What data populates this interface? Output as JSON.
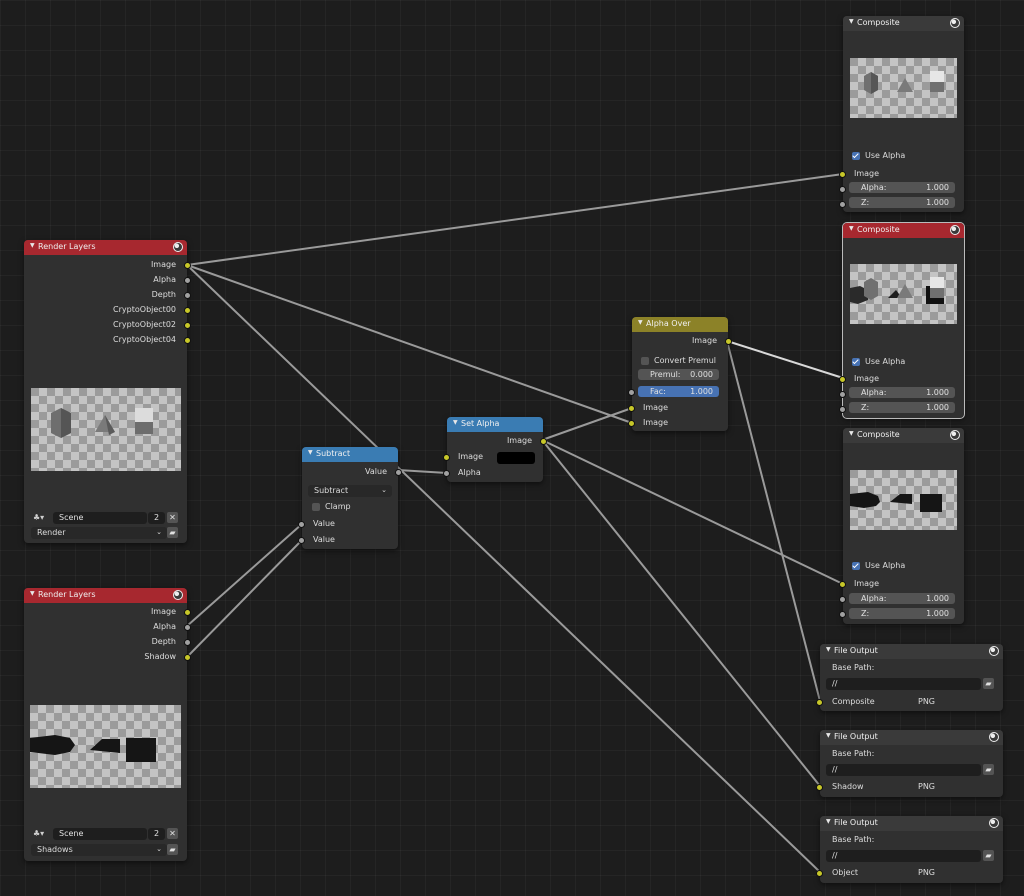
{
  "colors": {
    "render_layers_header": "#a7282f",
    "converter_header": "#3a7cb3",
    "mix_header": "#8c8228",
    "output_header": "#3a3a3a",
    "socket_color": "#c7c729",
    "socket_value": "#a1a1a1",
    "link": "#9a9a9a"
  },
  "render_layers_1": {
    "title": "Render Layers",
    "outputs": [
      "Image",
      "Alpha",
      "Depth",
      "CryptoObject00",
      "CryptoObject02",
      "CryptoObject04"
    ],
    "scene": "Scene",
    "scene_count": "2",
    "layer": "Render"
  },
  "render_layers_2": {
    "title": "Render Layers",
    "outputs": [
      "Image",
      "Alpha",
      "Depth",
      "Shadow"
    ],
    "scene": "Scene",
    "scene_count": "2",
    "layer": "Shadows"
  },
  "subtract": {
    "title": "Subtract",
    "output": "Value",
    "operation": "Subtract",
    "clamp_label": "Clamp",
    "inputs": [
      "Value",
      "Value"
    ]
  },
  "set_alpha": {
    "title": "Set Alpha",
    "output": "Image",
    "inputs": [
      "Image",
      "Alpha"
    ]
  },
  "alpha_over": {
    "title": "Alpha Over",
    "output": "Image",
    "convert_premul_label": "Convert Premul",
    "premul_label": "Premul:",
    "premul_value": "0.000",
    "fac_label": "Fac:",
    "fac_value": "1.000",
    "inputs": [
      "Image",
      "Image"
    ]
  },
  "composite_1": {
    "title": "Composite",
    "use_alpha_label": "Use Alpha",
    "input": "Image",
    "alpha_label": "Alpha:",
    "alpha_value": "1.000",
    "z_label": "Z:",
    "z_value": "1.000"
  },
  "composite_2": {
    "title": "Composite",
    "use_alpha_label": "Use Alpha",
    "input": "Image",
    "alpha_label": "Alpha:",
    "alpha_value": "1.000",
    "z_label": "Z:",
    "z_value": "1.000"
  },
  "composite_3": {
    "title": "Composite",
    "use_alpha_label": "Use Alpha",
    "input": "Image",
    "alpha_label": "Alpha:",
    "alpha_value": "1.000",
    "z_label": "Z:",
    "z_value": "1.000"
  },
  "file_output_1": {
    "title": "File Output",
    "base_path_label": "Base Path:",
    "path": "//",
    "input": "Composite",
    "format": "PNG"
  },
  "file_output_2": {
    "title": "File Output",
    "base_path_label": "Base Path:",
    "path": "//",
    "input": "Shadow",
    "format": "PNG"
  },
  "file_output_3": {
    "title": "File Output",
    "base_path_label": "Base Path:",
    "path": "//",
    "input": "Object",
    "format": "PNG"
  }
}
